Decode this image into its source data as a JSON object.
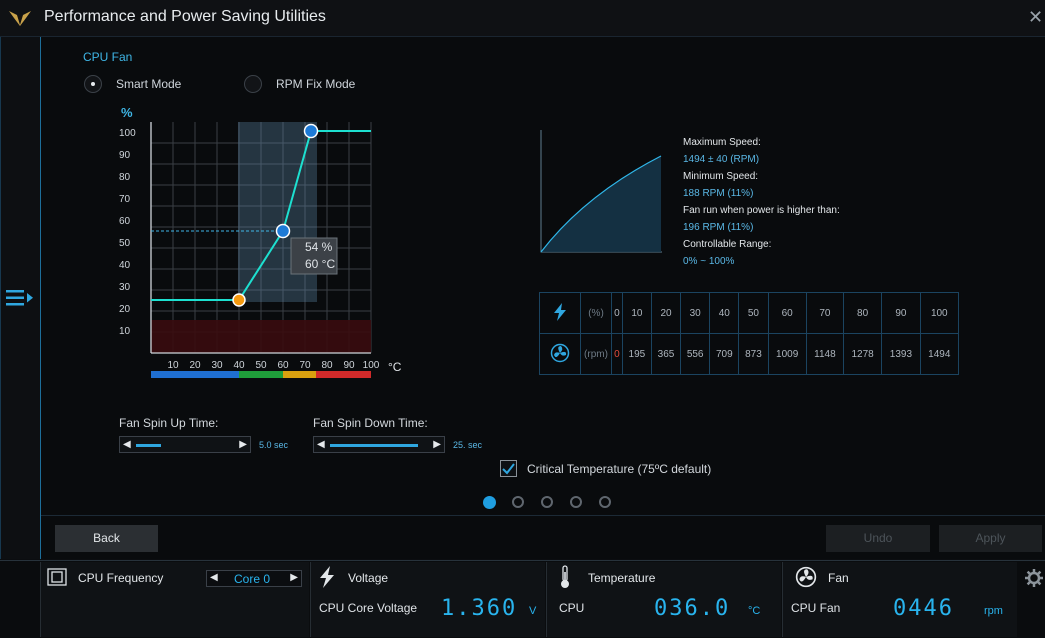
{
  "window": {
    "title": "Performance and Power Saving Utilities",
    "close_icon": "close-icon"
  },
  "fan": {
    "title": "CPU Fan",
    "modes": [
      {
        "label": "Smart Mode",
        "selected": true
      },
      {
        "label": "RPM Fix Mode",
        "selected": false
      }
    ],
    "graph": {
      "y_unit": "%",
      "y_ticks": [
        "100",
        "90",
        "80",
        "70",
        "60",
        "50",
        "40",
        "30",
        "20",
        "10"
      ],
      "x_ticks": [
        "10",
        "20",
        "30",
        "40",
        "50",
        "60",
        "70",
        "80",
        "90",
        "100"
      ],
      "x_unit": "°C",
      "points": [
        {
          "temp": 40,
          "pct": 20
        },
        {
          "temp": 60,
          "pct": 54
        },
        {
          "temp": 75,
          "pct": 100
        }
      ],
      "tooltip": {
        "pct": "54 %",
        "temp": "60 °C"
      },
      "band_colors": [
        "#1f6fd1",
        "#1f9e3a",
        "#d9a00f",
        "#d12a2a"
      ],
      "accent": "#1de0d0"
    },
    "info": {
      "max_speed_label": "Maximum Speed:",
      "max_speed_value": "1494 ± 40 (RPM)",
      "min_speed_label": "Minimum Speed:",
      "min_speed_value": "188 RPM (11%)",
      "power_label": "Fan run when power is higher than:",
      "power_value": "196 RPM (11%)",
      "range_label": "Controllable Range:",
      "range_value": "0% ~ 100%"
    },
    "table": {
      "pct_unit": "(%)",
      "rpm_unit": "(rpm)",
      "pct": [
        "0",
        "10",
        "20",
        "30",
        "40",
        "50",
        "60",
        "70",
        "80",
        "90",
        "100"
      ],
      "rpm": [
        "0",
        "195",
        "365",
        "556",
        "709",
        "873",
        "1009",
        "1148",
        "1278",
        "1393",
        "1494"
      ]
    },
    "spin_up": {
      "label": "Fan Spin Up Time:",
      "value": "5.0 sec",
      "fill": 0.45
    },
    "spin_down": {
      "label": "Fan Spin Down Time:",
      "value": "25. sec",
      "fill": 0.88
    },
    "critical": {
      "label": "Critical Temperature (75ºC default)",
      "checked": true
    },
    "page_dots": {
      "count": 5,
      "active": 0
    }
  },
  "buttons": {
    "back": "Back",
    "undo": "Undo",
    "apply": "Apply"
  },
  "status": {
    "cpu_freq": {
      "title": "CPU Frequency",
      "core": "Core 0"
    },
    "voltage": {
      "title": "Voltage",
      "label": "CPU Core Voltage",
      "value": "1.360",
      "unit": "V"
    },
    "temperature": {
      "title": "Temperature",
      "label": "CPU",
      "value": "036.0",
      "unit": "°C"
    },
    "fan": {
      "title": "Fan",
      "label": "CPU Fan",
      "value": "0446",
      "unit": "rpm"
    }
  }
}
